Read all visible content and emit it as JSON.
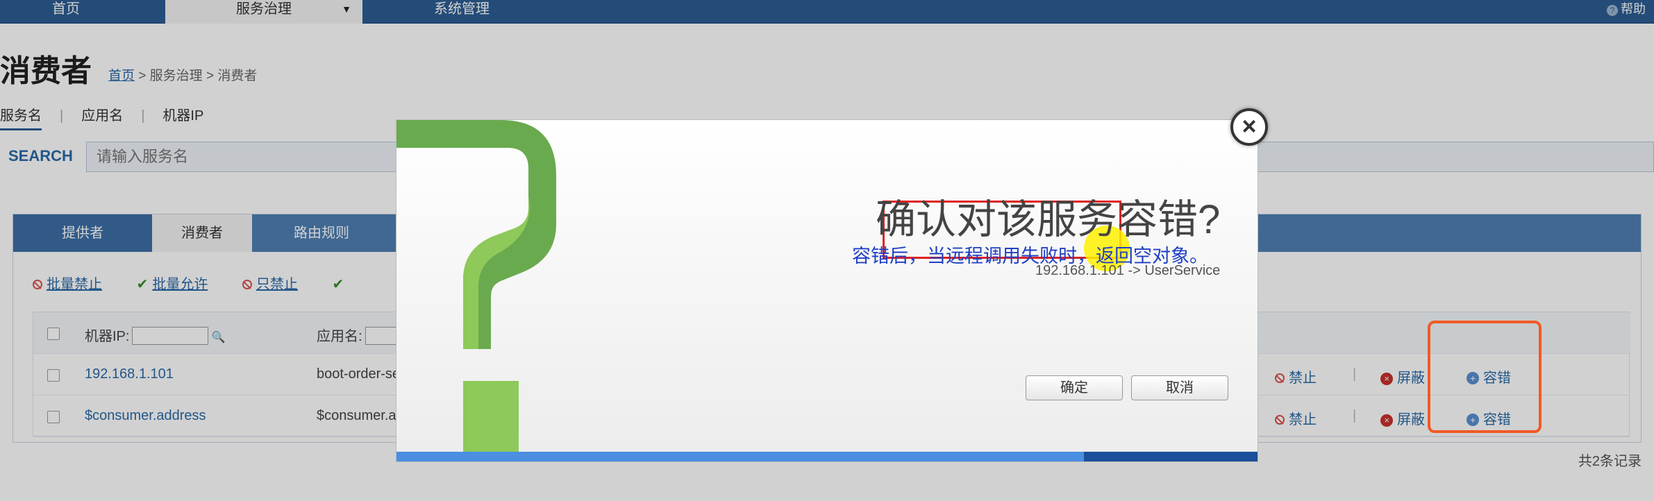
{
  "nav": {
    "home": "首页",
    "service_governance": "服务治理",
    "system_management": "系统管理",
    "help": "帮助"
  },
  "page": {
    "title": "消费者",
    "breadcrumb_home": "首页",
    "breadcrumb_rest": " > 服务治理 > 消费者"
  },
  "filters": [
    "服务名",
    "应用名",
    "机器IP"
  ],
  "search": {
    "label": "SEARCH",
    "placeholder": "请输入服务名"
  },
  "tabs": [
    "提供者",
    "消费者",
    "路由规则"
  ],
  "actions": {
    "batch_ban": "批量禁止",
    "batch_allow": "批量允许",
    "ban_only": "只禁止"
  },
  "table": {
    "header_ip": "机器IP:",
    "header_app": "应用名:",
    "rows": [
      {
        "ip": "192.168.1.101",
        "app": "boot-order-ser",
        "ban": "禁止",
        "shield": "屏蔽",
        "tolerance": "容错"
      },
      {
        "ip": "$consumer.address",
        "app": "$consumer.ap",
        "ban": "禁止",
        "shield": "屏蔽",
        "tolerance": "容错"
      }
    ],
    "total": "共2条记录"
  },
  "modal": {
    "title": "确认对该服务容错?",
    "subtitle": "容错后，当远程调用失败时，返回空对象。",
    "detail": "192.168.1.101 -> UserService",
    "ok": "确定",
    "cancel": "取消",
    "close": "×"
  },
  "colors": {
    "nav_bg": "#2c5d93",
    "link": "#2a6aa8",
    "modal_green": "#6aaa4e",
    "highlight_orange": "#f05a24",
    "highlight_red": "#e02020"
  }
}
